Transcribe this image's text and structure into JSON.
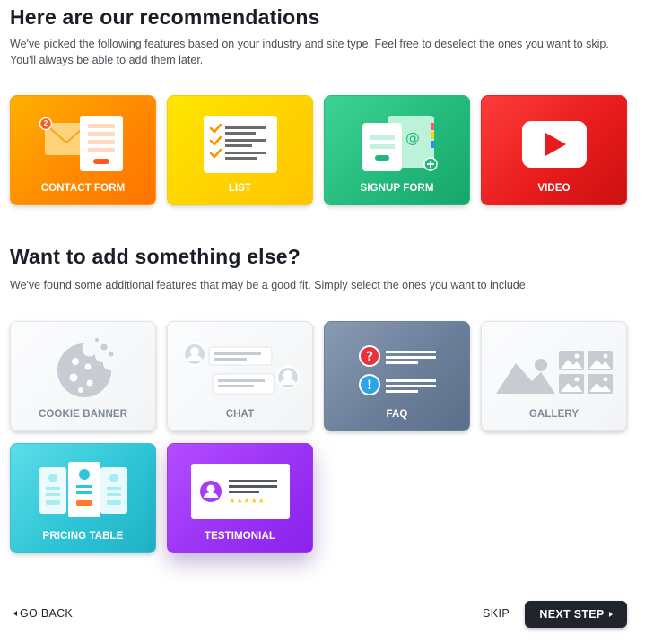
{
  "recommendations": {
    "title": "Here are our recommendations",
    "description": "We've picked the following features based on your industry and site type. Feel free to deselect the ones you want to skip. You'll always be able to add them later.",
    "cards": [
      {
        "label": "CONTACT FORM",
        "icon": "contact-form-icon",
        "badge": "2",
        "color": "#ff8a00"
      },
      {
        "label": "LIST",
        "icon": "checklist-icon",
        "color": "#ffd200"
      },
      {
        "label": "SIGNUP FORM",
        "icon": "signup-form-icon",
        "color": "#22b87a"
      },
      {
        "label": "VIDEO",
        "icon": "video-play-icon",
        "color": "#e81c1c"
      }
    ]
  },
  "additional": {
    "title": "Want to add something else?",
    "description": "We've found some additional features that may be a good fit. Simply select the ones you want to include.",
    "cards": [
      {
        "label": "COOKIE BANNER",
        "icon": "cookie-icon",
        "color": "#f2f4f6"
      },
      {
        "label": "CHAT",
        "icon": "chat-icon",
        "color": "#f2f4f6"
      },
      {
        "label": "FAQ",
        "icon": "faq-icon",
        "color": "#6b7f9a"
      },
      {
        "label": "GALLERY",
        "icon": "gallery-icon",
        "color": "#f2f4f6"
      },
      {
        "label": "PRICING TABLE",
        "icon": "pricing-table-icon",
        "color": "#2fc5d6"
      },
      {
        "label": "TESTIMONIAL",
        "icon": "testimonial-icon",
        "color": "#9b32f5"
      }
    ]
  },
  "footer": {
    "back_label": "GO BACK",
    "skip_label": "SKIP",
    "next_label": "NEXT STEP"
  }
}
